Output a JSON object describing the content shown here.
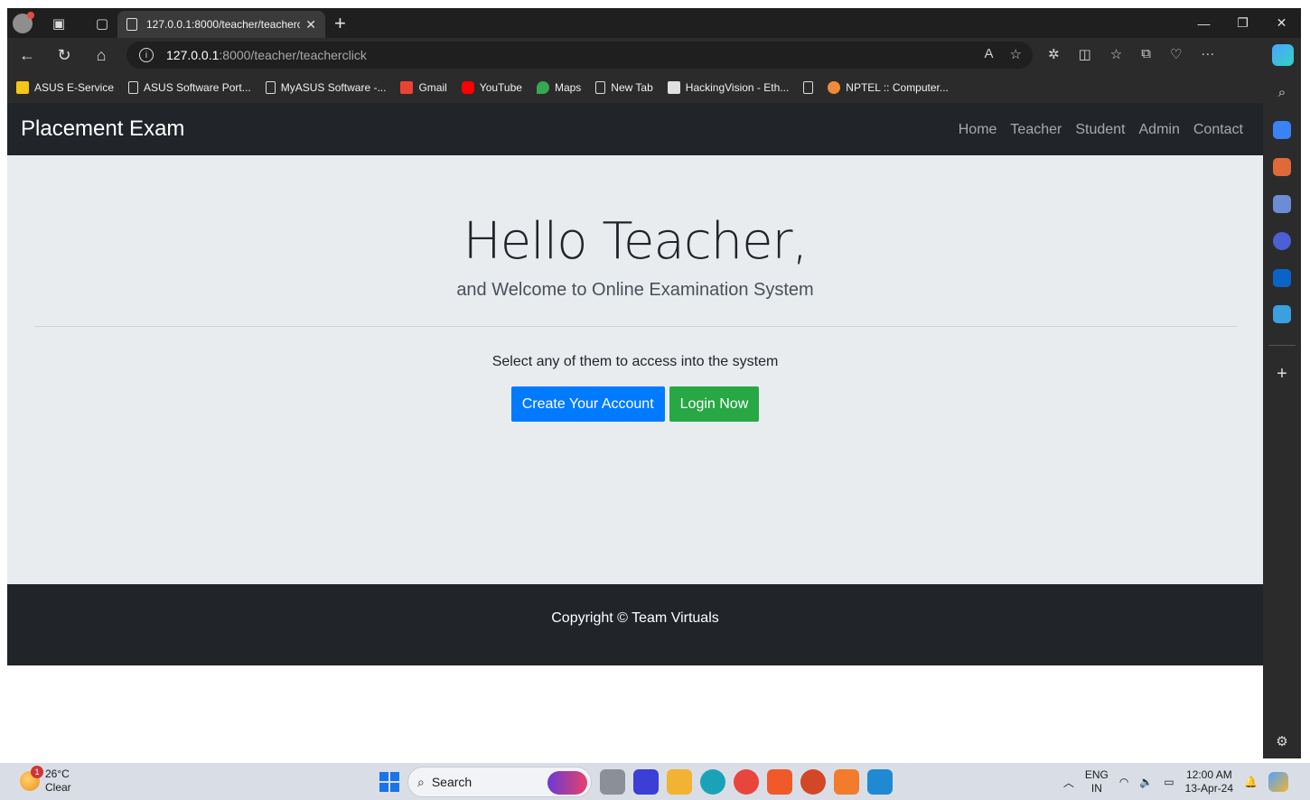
{
  "browser": {
    "tab_title": "127.0.0.1:8000/teacher/teacherclick",
    "url_host": "127.0.0.1",
    "url_path": ":8000/teacher/teacherclick",
    "bookmarks": [
      {
        "label": "ASUS E-Service",
        "icon": "folder-icon",
        "color": "#f5c518"
      },
      {
        "label": "ASUS Software Port...",
        "icon": "page-icon"
      },
      {
        "label": "MyASUS Software -...",
        "icon": "page-icon"
      },
      {
        "label": "Gmail",
        "icon": "gmail-icon",
        "color": "#ea4335"
      },
      {
        "label": "YouTube",
        "icon": "youtube-icon",
        "color": "#ff0000"
      },
      {
        "label": "Maps",
        "icon": "maps-icon",
        "color": "#34a853"
      },
      {
        "label": "New Tab",
        "icon": "page-icon"
      },
      {
        "label": "HackingVision - Eth...",
        "icon": "hackingvision-icon",
        "color": "#e0e0e0"
      },
      {
        "label": "",
        "icon": "page-icon"
      },
      {
        "label": "NPTEL :: Computer...",
        "icon": "nptel-icon",
        "color": "#f08a3a"
      }
    ]
  },
  "site": {
    "brand": "Placement Exam",
    "nav_links": [
      "Home",
      "Teacher",
      "Student",
      "Admin",
      "Contact"
    ],
    "heading": "Hello Teacher,",
    "lead": "and Welcome to Online Examination System",
    "prompt": "Select any of them to access into the system",
    "create_button": "Create Your Account",
    "login_button": "Login Now",
    "copyright": "Copyright © Team Virtuals",
    "colors": {
      "navbar": "#212529",
      "jumbotron": "#e9ecef",
      "primary": "#007bff",
      "success": "#28a745"
    }
  },
  "taskbar": {
    "temperature": "26°C",
    "weather": "Clear",
    "weather_badge": "1",
    "search_label": "Search",
    "language": "ENG",
    "region": "IN",
    "time": "12:00 AM",
    "date": "13-Apr-24"
  }
}
